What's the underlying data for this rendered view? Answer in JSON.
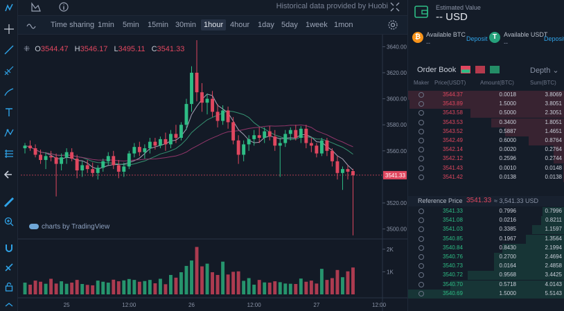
{
  "header": {
    "historical_note": "Historical data provided by Huobi"
  },
  "icons": {
    "left_tools": [
      "crosshair-icon",
      "trendline-icon",
      "fib-icon",
      "brush-icon",
      "text-icon",
      "pattern-icon",
      "measure-icon",
      "back-arrow-icon",
      "ruler-icon",
      "zoom-icon",
      "magnet-icon",
      "lock-draw-icon",
      "lock-icon",
      "expand-icon"
    ]
  },
  "intervals": [
    "Time sharing",
    "1min",
    "5min",
    "15min",
    "30min",
    "1hour",
    "4hour",
    "1day",
    "5day",
    "1week",
    "1mon"
  ],
  "active_interval": "1hour",
  "ohlc": {
    "o_label": "O",
    "o": "3544.47",
    "h_label": "H",
    "h": "3546.17",
    "l_label": "L",
    "l": "3495.11",
    "c_label": "C",
    "c": "3541.33"
  },
  "tradingview_label": "charts by TradingView",
  "chart_data": {
    "type": "candlestick",
    "price_axis_ticks": [
      "3640.00",
      "3620.00",
      "3600.00",
      "3580.00",
      "3560.00",
      "3540.00",
      "3520.00",
      "3500.00"
    ],
    "last_price_label": "3541.33",
    "volume_axis_ticks": [
      "2K",
      "1K"
    ],
    "time_axis_ticks": [
      "25",
      "12:00",
      "26",
      "12:00",
      "27",
      "12:00"
    ],
    "ylim": [
      3495,
      3645
    ],
    "candles": [
      {
        "o": 3562,
        "h": 3566,
        "l": 3558,
        "c": 3564
      },
      {
        "o": 3564,
        "h": 3568,
        "l": 3560,
        "c": 3562
      },
      {
        "o": 3562,
        "h": 3565,
        "l": 3555,
        "c": 3557
      },
      {
        "o": 3557,
        "h": 3561,
        "l": 3550,
        "c": 3553
      },
      {
        "o": 3553,
        "h": 3559,
        "l": 3546,
        "c": 3556
      },
      {
        "o": 3556,
        "h": 3560,
        "l": 3552,
        "c": 3555
      },
      {
        "o": 3555,
        "h": 3558,
        "l": 3525,
        "c": 3550
      },
      {
        "o": 3550,
        "h": 3558,
        "l": 3545,
        "c": 3555
      },
      {
        "o": 3555,
        "h": 3562,
        "l": 3550,
        "c": 3559
      },
      {
        "o": 3559,
        "h": 3562,
        "l": 3552,
        "c": 3554
      },
      {
        "o": 3554,
        "h": 3557,
        "l": 3539,
        "c": 3545
      },
      {
        "o": 3545,
        "h": 3552,
        "l": 3540,
        "c": 3549
      },
      {
        "o": 3549,
        "h": 3553,
        "l": 3543,
        "c": 3546
      },
      {
        "o": 3546,
        "h": 3551,
        "l": 3540,
        "c": 3543
      },
      {
        "o": 3543,
        "h": 3549,
        "l": 3538,
        "c": 3547
      },
      {
        "o": 3547,
        "h": 3554,
        "l": 3544,
        "c": 3552
      },
      {
        "o": 3552,
        "h": 3559,
        "l": 3549,
        "c": 3556
      },
      {
        "o": 3556,
        "h": 3560,
        "l": 3546,
        "c": 3549
      },
      {
        "o": 3549,
        "h": 3553,
        "l": 3539,
        "c": 3544
      },
      {
        "o": 3544,
        "h": 3551,
        "l": 3540,
        "c": 3548
      },
      {
        "o": 3548,
        "h": 3560,
        "l": 3546,
        "c": 3558
      },
      {
        "o": 3558,
        "h": 3566,
        "l": 3555,
        "c": 3563
      },
      {
        "o": 3563,
        "h": 3567,
        "l": 3556,
        "c": 3559
      },
      {
        "o": 3559,
        "h": 3565,
        "l": 3554,
        "c": 3562
      },
      {
        "o": 3562,
        "h": 3570,
        "l": 3558,
        "c": 3567
      },
      {
        "o": 3567,
        "h": 3570,
        "l": 3561,
        "c": 3564
      },
      {
        "o": 3564,
        "h": 3571,
        "l": 3562,
        "c": 3569
      },
      {
        "o": 3569,
        "h": 3574,
        "l": 3560,
        "c": 3565
      },
      {
        "o": 3565,
        "h": 3576,
        "l": 3562,
        "c": 3573
      },
      {
        "o": 3573,
        "h": 3580,
        "l": 3566,
        "c": 3570
      },
      {
        "o": 3570,
        "h": 3582,
        "l": 3568,
        "c": 3580
      },
      {
        "o": 3580,
        "h": 3600,
        "l": 3576,
        "c": 3596
      },
      {
        "o": 3596,
        "h": 3625,
        "l": 3590,
        "c": 3620
      },
      {
        "o": 3620,
        "h": 3645,
        "l": 3598,
        "c": 3605
      },
      {
        "o": 3605,
        "h": 3612,
        "l": 3590,
        "c": 3597
      },
      {
        "o": 3597,
        "h": 3604,
        "l": 3588,
        "c": 3600
      },
      {
        "o": 3600,
        "h": 3606,
        "l": 3586,
        "c": 3590
      },
      {
        "o": 3590,
        "h": 3596,
        "l": 3578,
        "c": 3583
      },
      {
        "o": 3583,
        "h": 3595,
        "l": 3580,
        "c": 3591
      },
      {
        "o": 3591,
        "h": 3594,
        "l": 3577,
        "c": 3582
      },
      {
        "o": 3582,
        "h": 3586,
        "l": 3565,
        "c": 3568
      },
      {
        "o": 3568,
        "h": 3572,
        "l": 3550,
        "c": 3557
      },
      {
        "o": 3557,
        "h": 3568,
        "l": 3552,
        "c": 3565
      },
      {
        "o": 3565,
        "h": 3572,
        "l": 3560,
        "c": 3569
      },
      {
        "o": 3569,
        "h": 3576,
        "l": 3564,
        "c": 3572
      },
      {
        "o": 3572,
        "h": 3578,
        "l": 3566,
        "c": 3570
      },
      {
        "o": 3570,
        "h": 3578,
        "l": 3566,
        "c": 3575
      },
      {
        "o": 3575,
        "h": 3579,
        "l": 3568,
        "c": 3571
      },
      {
        "o": 3571,
        "h": 3576,
        "l": 3560,
        "c": 3564
      },
      {
        "o": 3564,
        "h": 3570,
        "l": 3540,
        "c": 3566
      },
      {
        "o": 3566,
        "h": 3576,
        "l": 3563,
        "c": 3573
      },
      {
        "o": 3573,
        "h": 3578,
        "l": 3568,
        "c": 3576
      },
      {
        "o": 3576,
        "h": 3580,
        "l": 3568,
        "c": 3570
      },
      {
        "o": 3570,
        "h": 3579,
        "l": 3566,
        "c": 3577
      },
      {
        "o": 3577,
        "h": 3580,
        "l": 3562,
        "c": 3566
      },
      {
        "o": 3566,
        "h": 3570,
        "l": 3559,
        "c": 3564
      },
      {
        "o": 3564,
        "h": 3566,
        "l": 3555,
        "c": 3558
      },
      {
        "o": 3558,
        "h": 3570,
        "l": 3556,
        "c": 3568
      },
      {
        "o": 3568,
        "h": 3570,
        "l": 3556,
        "c": 3560
      },
      {
        "o": 3560,
        "h": 3562,
        "l": 3548,
        "c": 3552
      },
      {
        "o": 3552,
        "h": 3556,
        "l": 3538,
        "c": 3543
      },
      {
        "o": 3543,
        "h": 3548,
        "l": 3530,
        "c": 3546
      },
      {
        "o": 3546,
        "h": 3549,
        "l": 3538,
        "c": 3544
      },
      {
        "o": 3544.47,
        "h": 3546.17,
        "l": 3495.11,
        "c": 3541.33
      }
    ],
    "volumes": [
      520,
      430,
      610,
      560,
      470,
      690,
      480,
      580,
      470,
      520,
      640,
      460,
      420,
      400,
      610,
      560,
      520,
      650,
      580,
      620,
      680,
      640,
      560,
      590,
      640,
      490,
      690,
      450,
      860,
      740,
      980,
      1260,
      1500,
      2100,
      1240,
      1360,
      980,
      860,
      1450,
      880,
      1000,
      1020,
      600,
      720,
      430,
      640,
      530,
      520,
      580,
      540,
      480,
      470,
      460,
      700,
      560,
      610,
      480,
      1130,
      640,
      720,
      1080,
      760,
      1020,
      1190
    ],
    "volume_ylim": [
      0,
      2300
    ]
  },
  "wallet": {
    "est_label": "Estimated Value",
    "est_value": "-- USD"
  },
  "balances": [
    {
      "coin_symbol": "₿",
      "label": "Available BTC",
      "value": "--",
      "action": "Deposit",
      "color": "#f7931a"
    },
    {
      "coin_symbol": "T",
      "label": "Available USDT",
      "value": "--",
      "action": "Deposit",
      "color": "#26a17b"
    }
  ],
  "orderbook": {
    "title": "Order Book",
    "depth_label": "Depth",
    "columns": [
      "Maker",
      "Price(USDT)",
      "Amount(BTC)",
      "Sum(BTC)"
    ],
    "asks": [
      {
        "price": "3544.37",
        "amount": "0.0018",
        "sum": "3.8069",
        "depth": 1.0
      },
      {
        "price": "3543.89",
        "amount": "1.5000",
        "sum": "3.8051",
        "depth": 0.99
      },
      {
        "price": "3543.58",
        "amount": "0.5000",
        "sum": "2.3051",
        "depth": 0.6
      },
      {
        "price": "3543.53",
        "amount": "0.3400",
        "sum": "1.8051",
        "depth": 0.47
      },
      {
        "price": "3543.52",
        "amount": "0.5887",
        "sum": "1.4651",
        "depth": 0.38
      },
      {
        "price": "3542.49",
        "amount": "0.6000",
        "sum": "0.8764",
        "depth": 0.23
      },
      {
        "price": "3542.14",
        "amount": "0.0020",
        "sum": "0.2764",
        "depth": 0.07
      },
      {
        "price": "3542.12",
        "amount": "0.2596",
        "sum": "0.2744",
        "depth": 0.07
      },
      {
        "price": "3541.43",
        "amount": "0.0010",
        "sum": "0.0148",
        "depth": 0.01
      },
      {
        "price": "3541.42",
        "amount": "0.0138",
        "sum": "0.0138",
        "depth": 0.01
      }
    ],
    "reference_label": "Reference Price",
    "reference_price": "3541.33",
    "reference_usd": "≈ 3,541.33 USD",
    "bids": [
      {
        "price": "3541.33",
        "amount": "0.7996",
        "sum": "0.7996",
        "depth": 0.14
      },
      {
        "price": "3541.08",
        "amount": "0.0216",
        "sum": "0.8211",
        "depth": 0.15
      },
      {
        "price": "3541.03",
        "amount": "0.3385",
        "sum": "1.1597",
        "depth": 0.21
      },
      {
        "price": "3540.85",
        "amount": "0.1967",
        "sum": "1.3564",
        "depth": 0.25
      },
      {
        "price": "3540.84",
        "amount": "0.8430",
        "sum": "2.1994",
        "depth": 0.4
      },
      {
        "price": "3540.76",
        "amount": "0.2700",
        "sum": "2.4694",
        "depth": 0.45
      },
      {
        "price": "3540.73",
        "amount": "0.0164",
        "sum": "2.4858",
        "depth": 0.45
      },
      {
        "price": "3540.72",
        "amount": "0.9568",
        "sum": "3.4425",
        "depth": 0.62
      },
      {
        "price": "3540.70",
        "amount": "0.5718",
        "sum": "4.0143",
        "depth": 0.73
      },
      {
        "price": "3540.69",
        "amount": "1.5000",
        "sum": "5.5143",
        "depth": 1.0
      }
    ]
  },
  "colors": {
    "up": "#2ebd85",
    "down": "#e0475f",
    "ma1": "#b8b2c8",
    "ma2": "#3aa07a",
    "ma3": "#a13a72"
  }
}
